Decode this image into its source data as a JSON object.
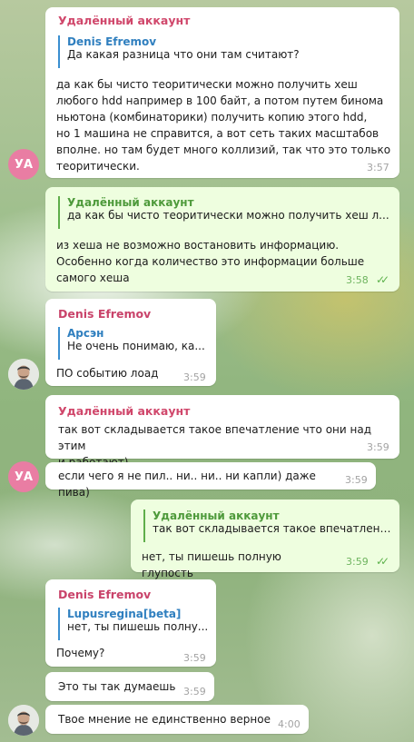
{
  "messages": [
    {
      "sender": "Удалённый аккаунт",
      "quote": {
        "name": "Denis Efremov",
        "text": "Да какая разница что они там считают?"
      },
      "text": "да как бы чисто теоритически можно получить хеш\nлюбого hdd например в 100 байт, а потом путем бинома\nньютона  (комбинаторики) получить копию этого hdd,\nно 1 машина не справится, а вот сеть таких масштабов\nвполне. но там будет много коллизий, так что это только\nтеоритически.",
      "time": "3:57"
    },
    {
      "quote": {
        "name": "Удалённый аккаунт",
        "text": "да как бы чисто теоритически можно получить хеш л..."
      },
      "text": "из хеша не возможно востановить информацию.\nОсобенно когда количество это информации больше\nсамого хеша",
      "time": "3:58"
    },
    {
      "sender": "Denis Efremov",
      "quote": {
        "name": "Арсэн",
        "text": "Не очень понимаю, ка..."
      },
      "text": "ПО событию лоад",
      "time": "3:59"
    },
    {
      "sender": "Удалённый аккаунт",
      "text": "так вот складывается такое впечатление что они над этим\nи работают)",
      "time": "3:59"
    },
    {
      "text": "если чего я не пил.. ни.. ни.. ни капли) даже пива)",
      "time": "3:59"
    },
    {
      "quote": {
        "name": "Удалённый аккаунт",
        "text": "так вот складывается такое впечатлени..."
      },
      "text": "нет, ты пишешь полную глупость",
      "time": "3:59"
    },
    {
      "sender": "Denis Efremov",
      "quote": {
        "name": "Lupusregina[beta]",
        "text": "нет, ты пишешь полну..."
      },
      "text": "Почему?",
      "time": "3:59"
    },
    {
      "text": "Это ты так думаешь",
      "time": "3:59"
    },
    {
      "text": "Твое мнение не единственно верное",
      "time": "4:00"
    }
  ],
  "avatars": {
    "deleted_initials": "УА",
    "denis_icon": "person-photo-icon"
  },
  "read_marks": "✓✓",
  "colors": {
    "incoming_bubble": "#ffffff",
    "outgoing_bubble": "#eefedf",
    "deleted_account_name": "#d0476b",
    "quote_bar_blue": "#3a8fd0",
    "quote_bar_green": "#5fae4a",
    "avatar_pink": "#e97da3"
  }
}
